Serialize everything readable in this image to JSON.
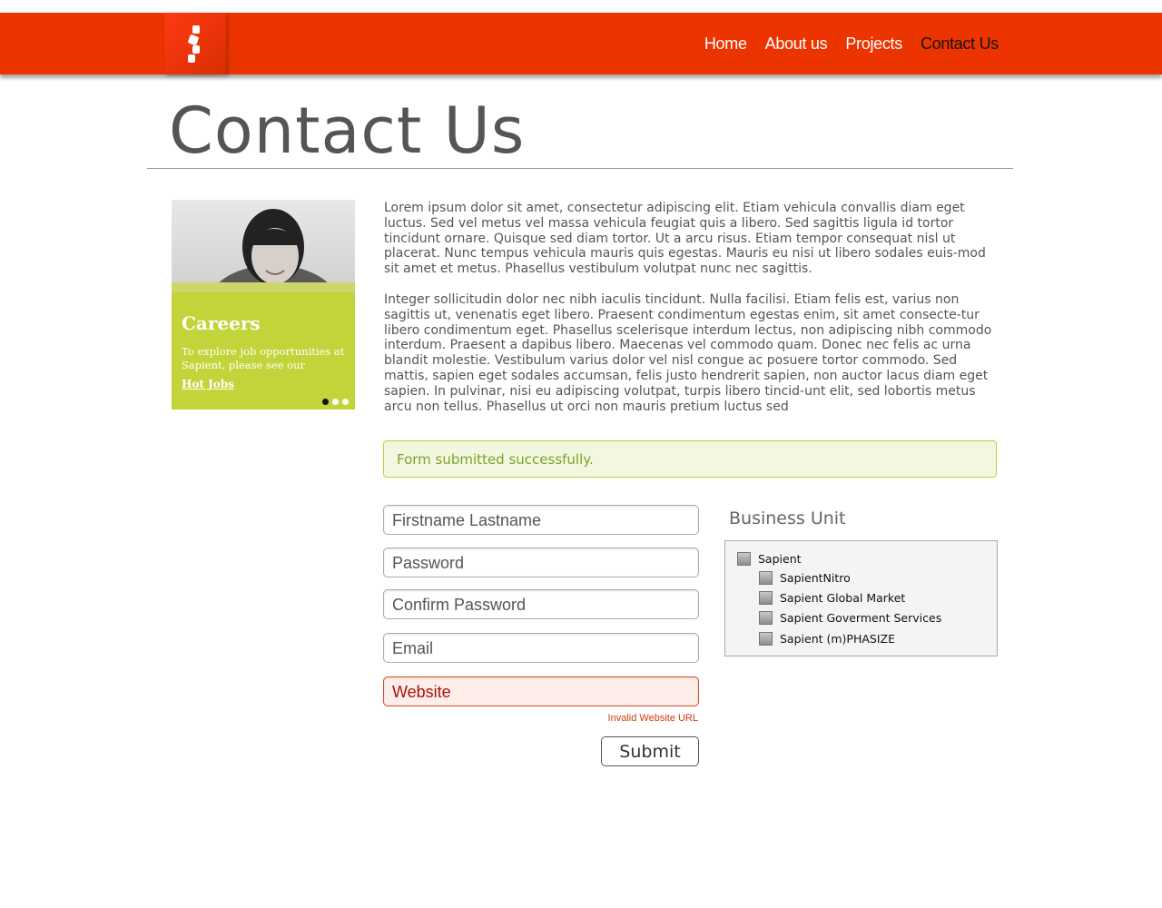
{
  "nav": {
    "home": "Home",
    "about": "About us",
    "projects": "Projects",
    "contact": "Contact Us"
  },
  "page_title": "Contact Us",
  "careers": {
    "title": "Careers",
    "text": "To explore job opportunities at Sapient, please see our",
    "link": "Hot Jobs"
  },
  "content": {
    "p1": "Lorem ipsum dolor sit amet, consectetur adipiscing elit. Etiam vehicula convallis diam eget luctus. Sed vel metus vel massa vehicula feugiat quis a libero. Sed sagittis ligula id tortor tincidunt ornare. Quisque sed diam tortor. Ut a arcu risus. Etiam tempor consequat nisl ut placerat. Nunc tempus vehicula mauris quis egestas. Mauris eu nisi ut libero sodales euis-mod sit amet et metus. Phasellus vestibulum volutpat nunc nec sagittis.",
    "p2": "Integer sollicitudin dolor nec nibh iaculis tincidunt. Nulla facilisi. Etiam felis est, varius non sagittis ut, venenatis eget libero. Praesent condimentum egestas enim, sit amet consecte-tur libero condimentum eget. Phasellus scelerisque interdum lectus, non adipiscing nibh commodo interdum. Praesent a dapibus libero. Maecenas vel commodo quam. Donec nec felis ac urna blandit molestie. Vestibulum varius dolor vel nisl congue ac posuere tortor commodo. Sed mattis, sapien eget sodales accumsan, felis justo hendrerit sapien, non auctor lacus diam eget sapien. In pulvinar, nisi eu adipiscing volutpat, turpis libero tincid-unt elit, sed lobortis metus arcu non tellus. Phasellus ut orci non mauris pretium luctus sed"
  },
  "form": {
    "success": "Form submitted successfully.",
    "name_placeholder": "Firstname Lastname",
    "password_placeholder": "Password",
    "confirm_placeholder": "Confirm Password",
    "email_placeholder": "Email",
    "website_placeholder": "Website",
    "website_error": "Invalid Website URL",
    "submit_label": "Submit"
  },
  "business_unit": {
    "title": "Business Unit",
    "items": [
      "Sapient",
      "SapientNitro",
      "Sapient Global Market",
      "Sapient Goverment Services",
      "Sapient (m)PHASIZE"
    ]
  },
  "colors": {
    "header": "#ec3400",
    "careers_bg": "#c2d43a",
    "success_border": "#b6cf45",
    "error": "#d23a12"
  },
  "careers_carousel": {
    "slides": 3,
    "active": 1
  }
}
